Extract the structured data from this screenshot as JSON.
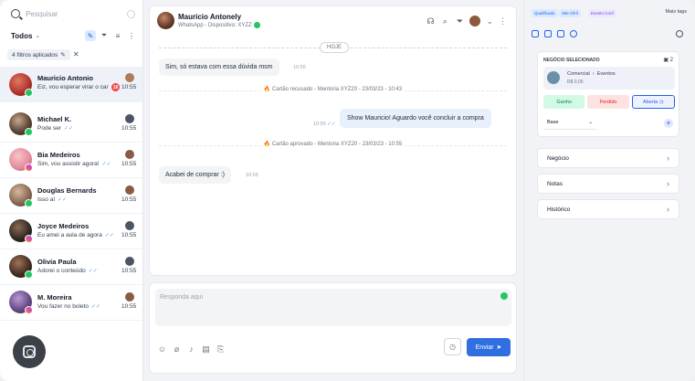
{
  "sidebar": {
    "search_placeholder": "Pesquisar",
    "filter_label": "Todos",
    "applied_filters": "4 filtros aplicados",
    "conversations": [
      {
        "name": "Mauricio Antonio",
        "preview": "Eiz, vou esperar virar o car",
        "time": "10:55",
        "unread": "18",
        "channel": "whatsapp",
        "avatar_color": "#b0302a"
      },
      {
        "name": "Michael K.",
        "preview": "Pode ser",
        "time": "10:55",
        "channel": "whatsapp",
        "avatar_color": "#3a3a3a"
      },
      {
        "name": "Bia Medeiros",
        "preview": "Sim, vou assistir agora!",
        "time": "10:55",
        "channel": "instagram",
        "avatar_color": "#e58fa0"
      },
      {
        "name": "Douglas Bernards",
        "preview": "Isso aí",
        "time": "10:55",
        "channel": "whatsapp",
        "avatar_color": "#8a6b55"
      },
      {
        "name": "Joyce Medeiros",
        "preview": "Eu amei a aula de agora",
        "time": "10:55",
        "channel": "instagram",
        "avatar_color": "#2e2620"
      },
      {
        "name": "Olivia Paula",
        "preview": "Adorei o conteúdo",
        "time": "10:55",
        "channel": "whatsapp",
        "avatar_color": "#3d2a1f"
      },
      {
        "name": "M. Moreira",
        "preview": "Vou fazer no boleto",
        "time": "10:55",
        "channel": "instagram",
        "avatar_color": "#6a4c8c"
      }
    ]
  },
  "chat": {
    "contact_name": "Mauricio Antonely",
    "contact_sub": "WhatsApp - Dispositivo: XYZZ",
    "day_label": "HOJE",
    "messages": [
      {
        "dir": "in",
        "text": "Sim, só estava com essa dúvida msm",
        "time": "10:55"
      },
      {
        "dir": "system",
        "text": "Cartão recusado - Mentoria XYZ20 - 23/03/23 - 10:43"
      },
      {
        "dir": "out",
        "text": "Show Mauricio! Aguardo você concluir a compra",
        "time": "10:55"
      },
      {
        "dir": "system",
        "text": "Cartão aprovado - Mentoria XYZ20 - 23/03/23 - 10:55"
      },
      {
        "dir": "in",
        "text": "Acabei de comprar :)",
        "time": "10:55"
      }
    ]
  },
  "composer": {
    "placeholder": "Responda aqui",
    "send_label": "Enviar"
  },
  "panel": {
    "tags": [
      "Qualificado",
      "Site Cliril",
      "Evento Conf"
    ],
    "more_tags": "Mais tags",
    "deal_title": "NEGÓCIO SELECIONADO",
    "deal_count": "2",
    "deal_pipeline_from": "Comercial",
    "deal_pipeline_to": "Eventos",
    "deal_value": "R$ 0,00",
    "won_label": "Ganho",
    "lost_label": "Perdido",
    "open_label": "Aberta",
    "base_label": "Base",
    "sections": [
      "Negócio",
      "Notas",
      "Histórico"
    ]
  },
  "colors": {
    "accent": "#2f6fe0",
    "whatsapp": "#22c55e",
    "alert": "#ef4444"
  }
}
